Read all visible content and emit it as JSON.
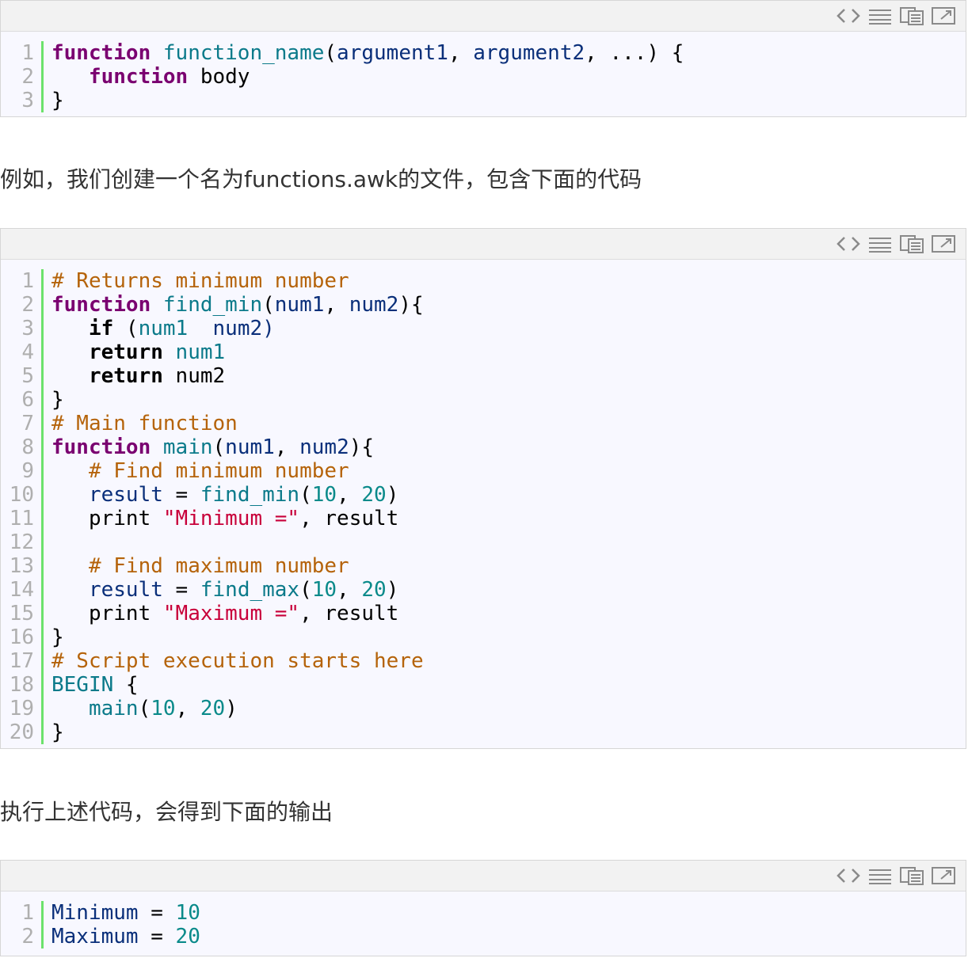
{
  "toolbar_icons": [
    "view-source-icon",
    "wrap-lines-icon",
    "copy-icon",
    "popup-icon"
  ],
  "code_block_1": {
    "line_numbers": [
      "1",
      "2",
      "3"
    ],
    "lines": [
      [
        {
          "t": "function",
          "c": "kw"
        },
        {
          "t": " ",
          "c": "plain"
        },
        {
          "t": "function_name",
          "c": "fn"
        },
        {
          "t": "(",
          "c": "plain"
        },
        {
          "t": "argument1",
          "c": "var"
        },
        {
          "t": ", ",
          "c": "plain"
        },
        {
          "t": "argument2",
          "c": "var"
        },
        {
          "t": ", ...) {",
          "c": "plain"
        }
      ],
      [
        {
          "t": "   function",
          "c": "kw"
        },
        {
          "t": " body",
          "c": "plain"
        }
      ],
      [
        {
          "t": "}",
          "c": "plain"
        }
      ]
    ]
  },
  "paragraph_1": "例如，我们创建一个名为functions.awk的文件，包含下面的代码",
  "code_block_2": {
    "line_numbers": [
      "1",
      "2",
      "3",
      "4",
      "5",
      "6",
      "7",
      "8",
      "9",
      "10",
      "11",
      "12",
      "13",
      "14",
      "15",
      "16",
      "17",
      "18",
      "19",
      "20"
    ],
    "lines": [
      [
        {
          "t": "# Returns minimum number",
          "c": "cm"
        }
      ],
      [
        {
          "t": "function",
          "c": "kw"
        },
        {
          "t": " ",
          "c": "plain"
        },
        {
          "t": "find_min",
          "c": "fn"
        },
        {
          "t": "(",
          "c": "plain"
        },
        {
          "t": "num1",
          "c": "var"
        },
        {
          "t": ", ",
          "c": "plain"
        },
        {
          "t": "num2",
          "c": "var"
        },
        {
          "t": "){",
          "c": "plain"
        }
      ],
      [
        {
          "t": "   ",
          "c": "plain"
        },
        {
          "t": "if",
          "c": "kw2"
        },
        {
          "t": " (",
          "c": "plain"
        },
        {
          "t": "num1",
          "c": "fn"
        },
        {
          "t": "  num2)",
          "c": "var"
        }
      ],
      [
        {
          "t": "   ",
          "c": "plain"
        },
        {
          "t": "return",
          "c": "kw2"
        },
        {
          "t": " ",
          "c": "plain"
        },
        {
          "t": "num1",
          "c": "fn"
        }
      ],
      [
        {
          "t": "   ",
          "c": "plain"
        },
        {
          "t": "return",
          "c": "kw2"
        },
        {
          "t": " num2",
          "c": "plain"
        }
      ],
      [
        {
          "t": "}",
          "c": "plain"
        }
      ],
      [
        {
          "t": "# Main function",
          "c": "cm"
        }
      ],
      [
        {
          "t": "function",
          "c": "kw"
        },
        {
          "t": " ",
          "c": "plain"
        },
        {
          "t": "main",
          "c": "fn"
        },
        {
          "t": "(",
          "c": "plain"
        },
        {
          "t": "num1",
          "c": "var"
        },
        {
          "t": ", ",
          "c": "plain"
        },
        {
          "t": "num2",
          "c": "var"
        },
        {
          "t": "){",
          "c": "plain"
        }
      ],
      [
        {
          "t": "   ",
          "c": "plain"
        },
        {
          "t": "# Find minimum number",
          "c": "cm"
        }
      ],
      [
        {
          "t": "   ",
          "c": "plain"
        },
        {
          "t": "result",
          "c": "var"
        },
        {
          "t": " = ",
          "c": "plain"
        },
        {
          "t": "find_min",
          "c": "fn"
        },
        {
          "t": "(",
          "c": "plain"
        },
        {
          "t": "10",
          "c": "num"
        },
        {
          "t": ", ",
          "c": "plain"
        },
        {
          "t": "20",
          "c": "num"
        },
        {
          "t": ")",
          "c": "plain"
        }
      ],
      [
        {
          "t": "   print ",
          "c": "plain"
        },
        {
          "t": "\"Minimum =\"",
          "c": "str"
        },
        {
          "t": ", result",
          "c": "plain"
        }
      ],
      [
        {
          "t": "",
          "c": "plain"
        }
      ],
      [
        {
          "t": "   ",
          "c": "plain"
        },
        {
          "t": "# Find maximum number",
          "c": "cm"
        }
      ],
      [
        {
          "t": "   ",
          "c": "plain"
        },
        {
          "t": "result",
          "c": "var"
        },
        {
          "t": " = ",
          "c": "plain"
        },
        {
          "t": "find_max",
          "c": "fn"
        },
        {
          "t": "(",
          "c": "plain"
        },
        {
          "t": "10",
          "c": "num"
        },
        {
          "t": ", ",
          "c": "plain"
        },
        {
          "t": "20",
          "c": "num"
        },
        {
          "t": ")",
          "c": "plain"
        }
      ],
      [
        {
          "t": "   print ",
          "c": "plain"
        },
        {
          "t": "\"Maximum =\"",
          "c": "str"
        },
        {
          "t": ", result",
          "c": "plain"
        }
      ],
      [
        {
          "t": "}",
          "c": "plain"
        }
      ],
      [
        {
          "t": "# Script execution starts here",
          "c": "cm"
        }
      ],
      [
        {
          "t": "BEGIN",
          "c": "fn"
        },
        {
          "t": " {",
          "c": "plain"
        }
      ],
      [
        {
          "t": "   ",
          "c": "plain"
        },
        {
          "t": "main",
          "c": "fn"
        },
        {
          "t": "(",
          "c": "plain"
        },
        {
          "t": "10",
          "c": "num"
        },
        {
          "t": ", ",
          "c": "plain"
        },
        {
          "t": "20",
          "c": "num"
        },
        {
          "t": ")",
          "c": "plain"
        }
      ],
      [
        {
          "t": "}",
          "c": "plain"
        }
      ]
    ]
  },
  "paragraph_2": "执行上述代码，会得到下面的输出",
  "code_block_3": {
    "line_numbers": [
      "1",
      "2"
    ],
    "lines": [
      [
        {
          "t": "Minimum",
          "c": "var"
        },
        {
          "t": " = ",
          "c": "plain"
        },
        {
          "t": "10",
          "c": "num"
        }
      ],
      [
        {
          "t": "Maximum",
          "c": "var"
        },
        {
          "t": " = ",
          "c": "plain"
        },
        {
          "t": "20",
          "c": "num"
        }
      ]
    ]
  }
}
